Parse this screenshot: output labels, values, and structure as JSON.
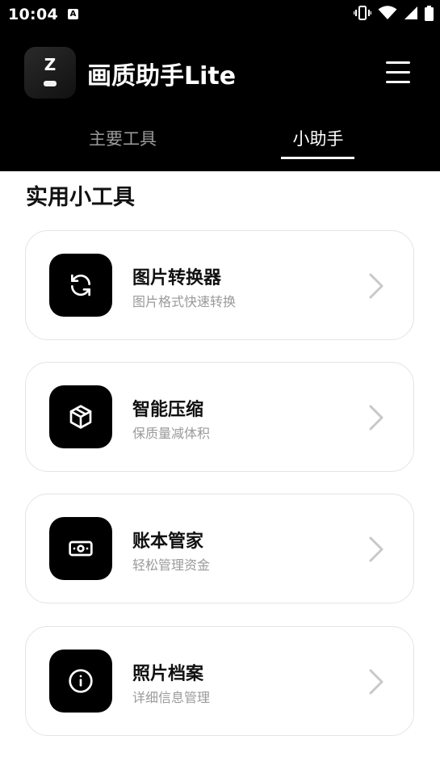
{
  "status_bar": {
    "time": "10:04",
    "notification_icon": "a-square-icon",
    "icons": [
      "vibrate-icon",
      "wifi-icon",
      "signal-icon",
      "battery-icon"
    ]
  },
  "header": {
    "logo_letter": "Z",
    "title": "画质助手Lite",
    "menu_icon": "hamburger-menu-icon"
  },
  "tabs": [
    {
      "label": "主要工具",
      "active": false
    },
    {
      "label": "小助手",
      "active": true
    }
  ],
  "section": {
    "title": "实用小工具"
  },
  "tools": [
    {
      "name": "图片转换器",
      "description": "图片格式快速转换",
      "icon": "refresh-icon"
    },
    {
      "name": "智能压缩",
      "description": "保质量减体积",
      "icon": "box-icon"
    },
    {
      "name": "账本管家",
      "description": "轻松管理资金",
      "icon": "banknote-icon"
    },
    {
      "name": "照片档案",
      "description": "详细信息管理",
      "icon": "info-icon"
    }
  ],
  "colors": {
    "header_bg": "#000000",
    "page_bg": "#ffffff",
    "card_border": "#e4e4e4",
    "muted_text": "#9a9a9a",
    "icon_tile": "#000000"
  }
}
